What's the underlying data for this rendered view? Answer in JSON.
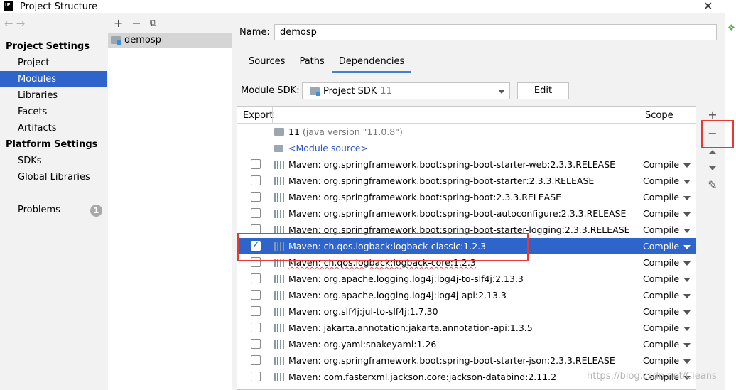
{
  "window": {
    "title": "Project Structure",
    "logo": "IE",
    "close_glyph": "✕"
  },
  "nav": {
    "back": "←",
    "forward": "→"
  },
  "sidebar": {
    "project_settings_label": "Project Settings",
    "project_settings": [
      {
        "label": "Project"
      },
      {
        "label": "Modules",
        "active": true
      },
      {
        "label": "Libraries"
      },
      {
        "label": "Facets"
      },
      {
        "label": "Artifacts"
      }
    ],
    "platform_settings_label": "Platform Settings",
    "platform_settings": [
      {
        "label": "SDKs"
      },
      {
        "label": "Global Libraries"
      }
    ],
    "problems": {
      "label": "Problems",
      "count": "1"
    }
  },
  "module_tree": {
    "toolbar": {
      "add": "+",
      "remove": "−",
      "copy": "⧉"
    },
    "modules": [
      {
        "name": "demosp"
      }
    ]
  },
  "module": {
    "name_label": "Name:",
    "name_value": "demosp",
    "tabs": [
      {
        "label": "Sources"
      },
      {
        "label": "Paths"
      },
      {
        "label": "Dependencies",
        "active": true
      }
    ],
    "sdk_label": "Module SDK:",
    "sdk_value": "Project SDK",
    "sdk_version": "11",
    "edit_label": "Edit"
  },
  "table": {
    "headers": {
      "export": "Export",
      "scope": "Scope"
    },
    "sdk_row": {
      "name": "11",
      "detail": "(java version \"11.0.8\")"
    },
    "source_row": {
      "name": "<Module source>"
    },
    "rows": [
      {
        "name": "Maven: org.springframework.boot:spring-boot-starter-web:2.3.3.RELEASE",
        "scope": "Compile",
        "checked": false,
        "selected": false
      },
      {
        "name": "Maven: org.springframework.boot:spring-boot-starter:2.3.3.RELEASE",
        "scope": "Compile",
        "checked": false,
        "selected": false
      },
      {
        "name": "Maven: org.springframework.boot:spring-boot:2.3.3.RELEASE",
        "scope": "Compile",
        "checked": false,
        "selected": false
      },
      {
        "name": "Maven: org.springframework.boot:spring-boot-autoconfigure:2.3.3.RELEASE",
        "scope": "Compile",
        "checked": false,
        "selected": false
      },
      {
        "name": "Maven: org.springframework.boot:spring-boot-starter-logging:2.3.3.RELEASE",
        "scope": "Compile",
        "checked": false,
        "selected": false
      },
      {
        "name": "Maven: ch.qos.logback:logback-classic:1.2.3",
        "scope": "Compile",
        "checked": true,
        "selected": true
      },
      {
        "name": "Maven: ch.qos.logback:logback-core:1.2.3",
        "scope": "Compile",
        "checked": false,
        "selected": false,
        "squiggle": true
      },
      {
        "name": "Maven: org.apache.logging.log4j:log4j-to-slf4j:2.13.3",
        "scope": "Compile",
        "checked": false,
        "selected": false
      },
      {
        "name": "Maven: org.apache.logging.log4j:log4j-api:2.13.3",
        "scope": "Compile",
        "checked": false,
        "selected": false
      },
      {
        "name": "Maven: org.slf4j:jul-to-slf4j:1.7.30",
        "scope": "Compile",
        "checked": false,
        "selected": false
      },
      {
        "name": "Maven: jakarta.annotation:jakarta.annotation-api:1.3.5",
        "scope": "Compile",
        "checked": false,
        "selected": false
      },
      {
        "name": "Maven: org.yaml:snakeyaml:1.26",
        "scope": "Compile",
        "checked": false,
        "selected": false
      },
      {
        "name": "Maven: org.springframework.boot:spring-boot-starter-json:2.3.3.RELEASE",
        "scope": "Compile",
        "checked": false,
        "selected": false
      },
      {
        "name": "Maven: com.fasterxml.jackson.core:jackson-databind:2.11.2",
        "scope": "Compile",
        "checked": false,
        "selected": false
      }
    ]
  },
  "side_actions": {
    "add": "+",
    "remove": "−",
    "edit": "✎"
  },
  "annotation_color": "#e53935",
  "selection_color": "#2f65ca",
  "watermark": "https://blog.csdn.net/Cleans"
}
